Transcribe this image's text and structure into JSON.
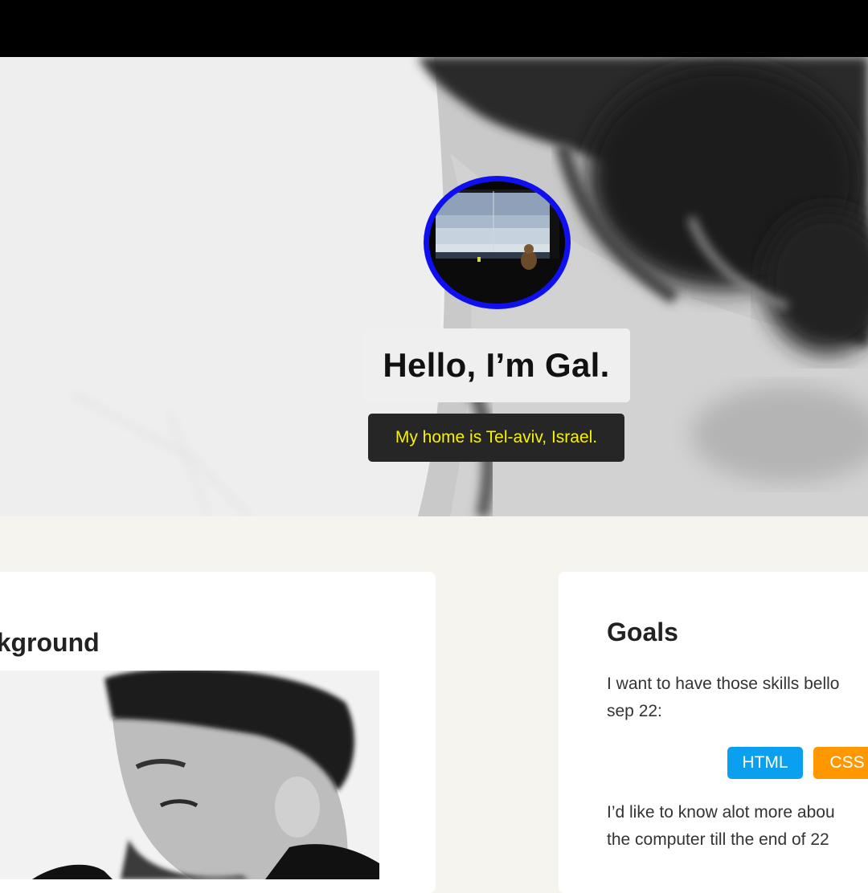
{
  "hero": {
    "title": "Hello, I’m Gal.",
    "subtitle": "My home is Tel-aviv, Israel.",
    "avatar_alt": "window view of the sea with a cat"
  },
  "background_card": {
    "title_visible": "nd",
    "title_full": "Background",
    "photo_alt": "black and white portrait"
  },
  "goals_card": {
    "title": "Goals",
    "text1_line1": "I want to have those skills bello",
    "text1_line2": "sep 22:",
    "badges": [
      "HTML",
      "CSS"
    ],
    "text2_line1": "I’d like to know alot more abou",
    "text2_line2": "the computer till the end of 22"
  },
  "colors": {
    "avatar_border": "#1010ee",
    "subtitle_text": "#f7f300",
    "badge_html": "#0aa0ef",
    "badge_css": "#ff9800",
    "page_bg": "#f5f4ef"
  }
}
